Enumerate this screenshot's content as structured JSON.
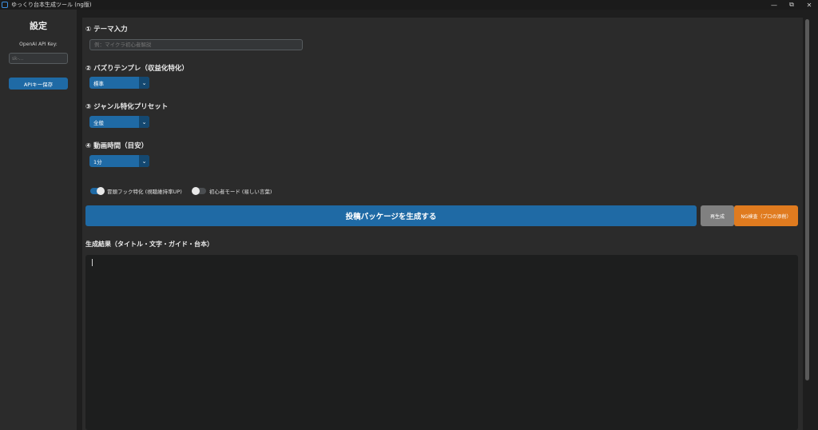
{
  "window": {
    "title": "ゆっくり台本生成ツール (ng版)",
    "controls": {
      "minimize": "—",
      "restore": "⧉",
      "close": "✕"
    }
  },
  "sidebar": {
    "title": "設定",
    "api_key_label": "OpenAI API Key:",
    "api_key_placeholder": "sk-...",
    "save_button": "APIキー保存"
  },
  "main": {
    "theme": {
      "label": "① テーマ入力",
      "placeholder": "例：マイクラ初心者解説"
    },
    "template": {
      "label": "② バズりテンプレ（収益化特化）",
      "selected": "標準"
    },
    "genre": {
      "label": "③ ジャンル特化プリセット",
      "selected": "全般"
    },
    "duration": {
      "label": "④ 動画時間（目安）",
      "selected": "1分"
    },
    "toggles": [
      {
        "label": "冒頭フック特化 (視聴維持率UP)",
        "on": true
      },
      {
        "label": "初心者モード (易しい言葉)",
        "on": false
      }
    ],
    "generate_button": "投稿パッケージを生成する",
    "regen_button": "再生成",
    "ng_button": "NG検査（プロの添削）",
    "result": {
      "label": "生成結果（タイトル・文字・ガイド・台本）",
      "text": ""
    }
  },
  "colors": {
    "accent": "#1f6aa5",
    "accent_dark": "#144870",
    "warning": "#e07b1f",
    "neutral_button": "#808080",
    "panel": "#2b2b2b",
    "background": "#1e1e1e"
  }
}
